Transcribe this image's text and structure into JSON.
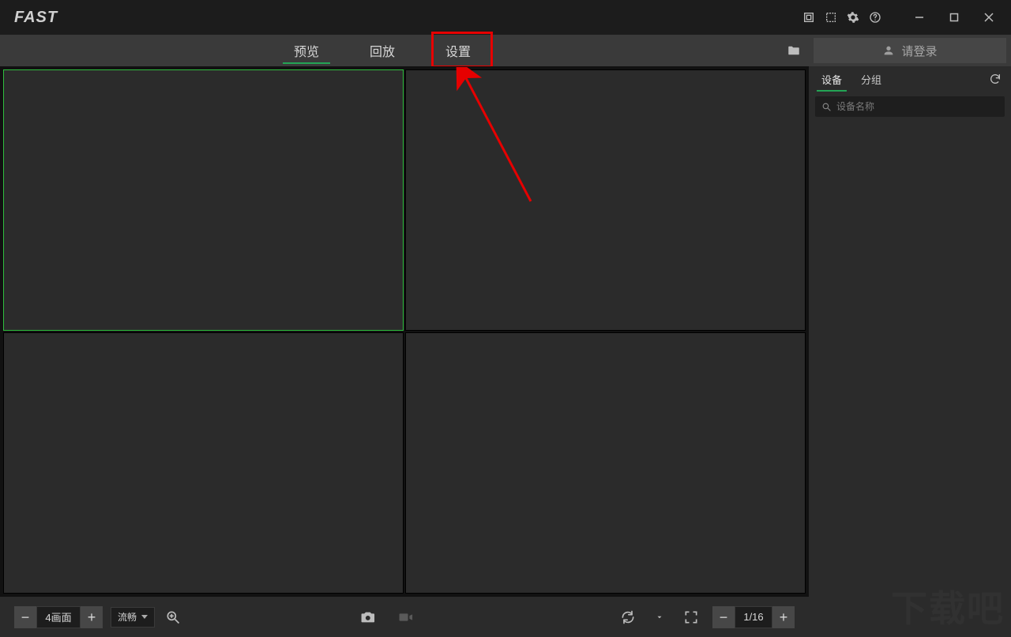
{
  "app": {
    "logo_text": "FAST"
  },
  "nav": {
    "tabs": [
      {
        "label": "预览",
        "active": true
      },
      {
        "label": "回放"
      },
      {
        "label": "设置",
        "highlighted": true
      }
    ],
    "login_label": "请登录"
  },
  "sidebar": {
    "tabs": [
      {
        "label": "设备",
        "active": true
      },
      {
        "label": "分组"
      }
    ],
    "search_placeholder": "设备名称"
  },
  "bottom": {
    "layout_label": "4画面",
    "stream_label": "流畅",
    "page_label": "1/16"
  },
  "icons": {
    "screenshot_tool": "screenshot",
    "layout_tool": "layout",
    "gear": "gear",
    "help": "help",
    "minimize": "minimize",
    "maximize": "maximize",
    "close": "close",
    "folder": "folder",
    "user": "user",
    "refresh": "refresh",
    "search": "search",
    "zoom": "zoom",
    "camera": "camera",
    "record": "record",
    "cycle": "cycle",
    "fullscreen": "fullscreen"
  }
}
